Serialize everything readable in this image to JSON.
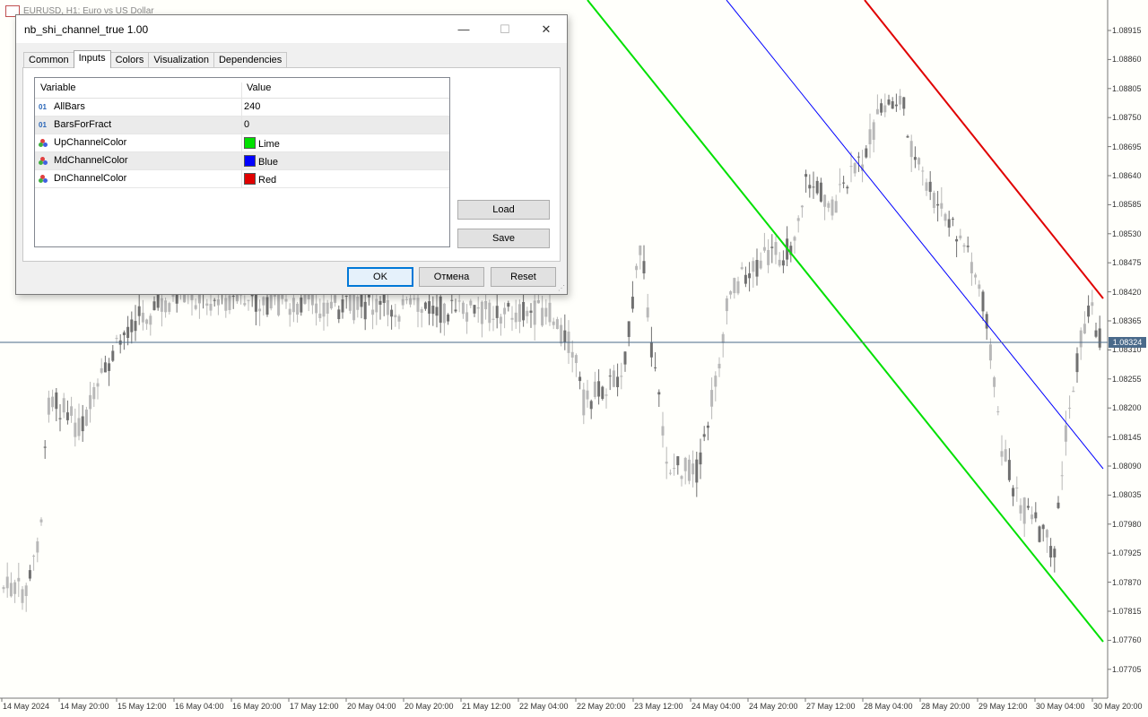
{
  "chart": {
    "header_text": "EURUSD, H1: Euro vs US Dollar",
    "current_price": "1.08324",
    "price_labels": [
      "1.08915",
      "1.08860",
      "1.08805",
      "1.08750",
      "1.08695",
      "1.08640",
      "1.08585",
      "1.08530",
      "1.08475",
      "1.08420",
      "1.08365",
      "1.08310",
      "1.08255",
      "1.08200",
      "1.08145",
      "1.08090",
      "1.08035",
      "1.07980",
      "1.07925",
      "1.07870",
      "1.07815",
      "1.07760",
      "1.07705"
    ],
    "time_labels": [
      "14 May 2024",
      "14 May 20:00",
      "15 May 12:00",
      "16 May 04:00",
      "16 May 20:00",
      "17 May 12:00",
      "20 May 04:00",
      "20 May 20:00",
      "21 May 12:00",
      "22 May 04:00",
      "22 May 20:00",
      "23 May 12:00",
      "24 May 04:00",
      "24 May 20:00",
      "27 May 12:00",
      "28 May 04:00",
      "28 May 20:00",
      "29 May 12:00",
      "30 May 04:00",
      "30 May 20:00"
    ],
    "colors": {
      "up_channel": "#00e000",
      "md_channel": "#0000ff",
      "dn_channel": "#e00000",
      "candles": "#b8b8b8",
      "candles_dark": "#707070",
      "price_line": "#4a6a8a"
    }
  },
  "dialog": {
    "title": "nb_shi_channel_true 1.00",
    "window_buttons": {
      "minimize": "—",
      "maximize": "☐",
      "close": "✕"
    },
    "tabs": [
      {
        "label": "Common",
        "active": false
      },
      {
        "label": "Inputs",
        "active": true
      },
      {
        "label": "Colors",
        "active": false
      },
      {
        "label": "Visualization",
        "active": false
      },
      {
        "label": "Dependencies",
        "active": false
      }
    ],
    "grid": {
      "headers": {
        "variable": "Variable",
        "value": "Value"
      },
      "rows": [
        {
          "icon": "int-icon",
          "icon_text": "01",
          "variable": "AllBars",
          "value": "240",
          "swatch": null
        },
        {
          "icon": "int-icon",
          "icon_text": "01",
          "variable": "BarsForFract",
          "value": "0",
          "swatch": null
        },
        {
          "icon": "color-icon",
          "icon_text": "",
          "variable": "UpChannelColor",
          "value": "Lime",
          "swatch": "#00e000"
        },
        {
          "icon": "color-icon",
          "icon_text": "",
          "variable": "MdChannelColor",
          "value": "Blue",
          "swatch": "#0000ff"
        },
        {
          "icon": "color-icon",
          "icon_text": "",
          "variable": "DnChannelColor",
          "value": "Red",
          "swatch": "#e00000"
        }
      ]
    },
    "load_label": "Load",
    "save_label": "Save",
    "ok_label": "OK",
    "cancel_label": "Отмена",
    "reset_label": "Reset"
  }
}
